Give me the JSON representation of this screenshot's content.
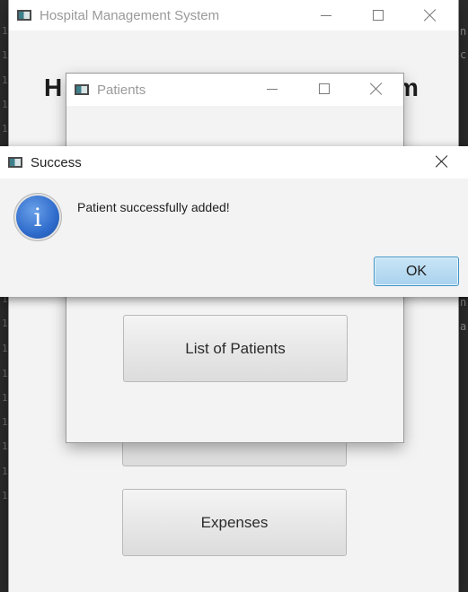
{
  "main_window": {
    "title": "Hospital Management System",
    "heading_left": "H",
    "heading_right": "m",
    "buttons": {
      "expenses": "Expenses"
    }
  },
  "patients_window": {
    "title": "Patients",
    "buttons": {
      "list_of_patients": "List of Patients"
    }
  },
  "dialog": {
    "title": "Success",
    "message": "Patient successfully added!",
    "ok_label": "OK"
  },
  "ide_background": {
    "gutter_digits": [
      "1",
      "1",
      "1",
      "1",
      "1",
      "1",
      "1",
      "1",
      "1",
      "1",
      "1",
      "1",
      "1",
      "1",
      "1",
      "1",
      "1",
      "1",
      "1",
      "1"
    ],
    "right_chars": [
      "n",
      "c",
      "n",
      "a"
    ]
  },
  "colors": {
    "accent": "#3c93c6",
    "info_icon": "#2f6ccc"
  }
}
